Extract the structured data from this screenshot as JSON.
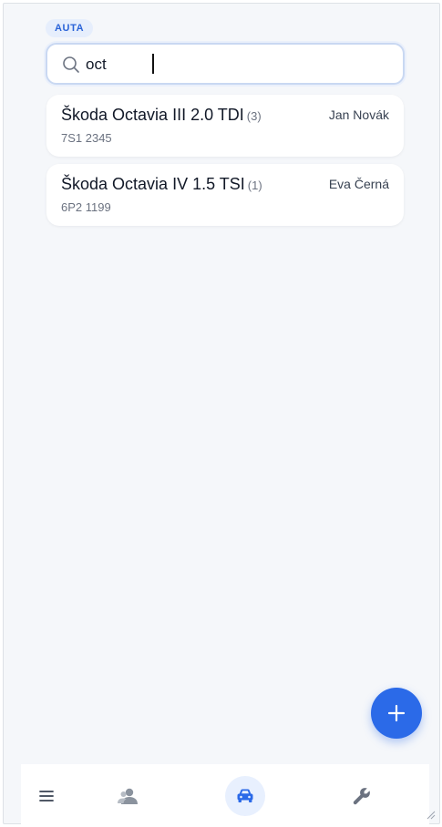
{
  "section": {
    "label": "AUTA"
  },
  "search": {
    "value": "oct",
    "placeholder": ""
  },
  "results": [
    {
      "model": "Škoda Octavia III 2.0 TDI",
      "count": "(3)",
      "plate": "7S1 2345",
      "owner": "Jan Novák"
    },
    {
      "model": "Škoda Octavia IV 1.5 TSI",
      "count": "(1)",
      "plate": "6P2 1199",
      "owner": "Eva Černá"
    }
  ],
  "fab": {
    "icon": "plus-icon"
  },
  "nav": {
    "items": [
      {
        "icon": "menu-icon",
        "active": false
      },
      {
        "icon": "customers-icon",
        "active": false
      },
      {
        "icon": "car-icon",
        "active": true
      },
      {
        "icon": "wrench-icon",
        "active": false
      }
    ]
  },
  "colors": {
    "accent": "#2b6ae8",
    "background": "#f5f7fa",
    "card": "#ffffff",
    "chip_bg": "#e6eefc",
    "chip_text": "#2b64d8"
  }
}
